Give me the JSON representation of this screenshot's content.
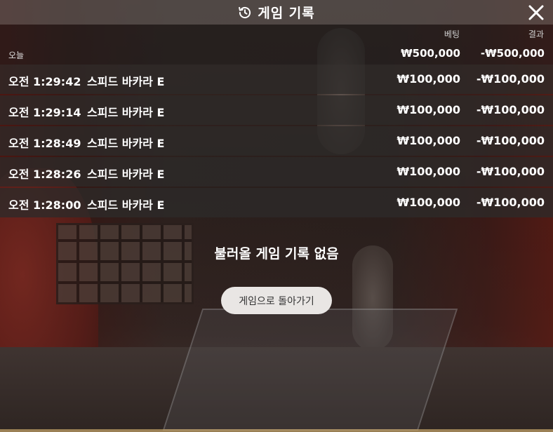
{
  "header": {
    "title": "게임 기록",
    "icon": "history-icon",
    "close_icon": "close-icon"
  },
  "columns": {
    "bet": "베팅",
    "result": "결과"
  },
  "day": {
    "label": "오늘",
    "total_bet": "₩500,000",
    "total_result": "-₩500,000"
  },
  "rows": [
    {
      "time": "오전 1:29:42",
      "game": "스피드 바카라 E",
      "bet": "₩100,000",
      "result": "-₩100,000"
    },
    {
      "time": "오전 1:29:14",
      "game": "스피드 바카라 E",
      "bet": "₩100,000",
      "result": "-₩100,000"
    },
    {
      "time": "오전 1:28:49",
      "game": "스피드 바카라 E",
      "bet": "₩100,000",
      "result": "-₩100,000"
    },
    {
      "time": "오전 1:28:26",
      "game": "스피드 바카라 E",
      "bet": "₩100,000",
      "result": "-₩100,000"
    },
    {
      "time": "오전 1:28:00",
      "game": "스피드 바카라 E",
      "bet": "₩100,000",
      "result": "-₩100,000"
    }
  ],
  "empty_message": "불러올 게임 기록 없음",
  "back_button": "게임으로 돌아가기"
}
